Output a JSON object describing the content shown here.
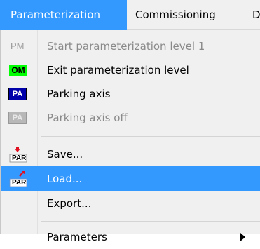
{
  "menubar": {
    "items": [
      {
        "label": "Parameterization"
      },
      {
        "label": "Commissioning"
      },
      {
        "label": "D"
      }
    ]
  },
  "menu": {
    "items": [
      {
        "label": "Start parameterization level 1",
        "icon": "PM"
      },
      {
        "label": "Exit parameterization level",
        "icon": "OM"
      },
      {
        "label": "Parking axis",
        "icon": "PA"
      },
      {
        "label": "Parking axis off",
        "icon": "PA"
      },
      {
        "label": "Save...",
        "icon": "PAR"
      },
      {
        "label": "Load...",
        "icon": "PAR"
      },
      {
        "label": "Export..."
      },
      {
        "label": "Parameters"
      }
    ]
  },
  "colors": {
    "highlight": "#3399ff",
    "menu_bg": "#f0f0f0",
    "disabled_text": "#8a8a8a",
    "om_icon_bg": "#00ff00",
    "pa_icon_bg": "#0000aa",
    "par_arrow": "#e01020"
  }
}
